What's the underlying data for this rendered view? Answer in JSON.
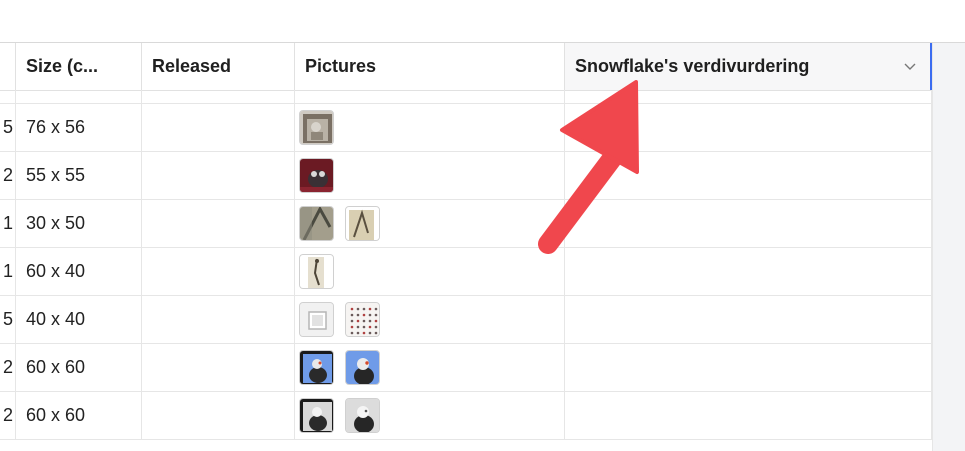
{
  "columns": [
    {
      "label": ""
    },
    {
      "label": "Size (c..."
    },
    {
      "label": "Released"
    },
    {
      "label": "Pictures"
    },
    {
      "label": "Snowflake's verdivurdering"
    }
  ],
  "rows": [
    {
      "prefix": "5",
      "size": "76 x 56",
      "released": "",
      "thumbs": [
        "cat-box"
      ]
    },
    {
      "prefix": "2",
      "size": "55 x 55",
      "released": "",
      "thumbs": [
        "owl-red"
      ]
    },
    {
      "prefix": "1",
      "size": "30 x 50",
      "released": "",
      "thumbs": [
        "branch-grey",
        "branch-tan"
      ]
    },
    {
      "prefix": "1",
      "size": "60 x 40",
      "released": "",
      "thumbs": [
        "stick-figure"
      ]
    },
    {
      "prefix": "5",
      "size": "40 x 40",
      "released": "",
      "thumbs": [
        "frame-grey",
        "dots-grid"
      ]
    },
    {
      "prefix": "2",
      "size": "60 x 60",
      "released": "",
      "thumbs": [
        "bird-blue-framed",
        "bird-blue"
      ]
    },
    {
      "prefix": "2",
      "size": "60 x 60",
      "released": "",
      "thumbs": [
        "bird-grey-framed",
        "bird-grey"
      ]
    }
  ],
  "colors": {
    "accent": "#3b6cf0",
    "arrow": "#f0474d"
  }
}
